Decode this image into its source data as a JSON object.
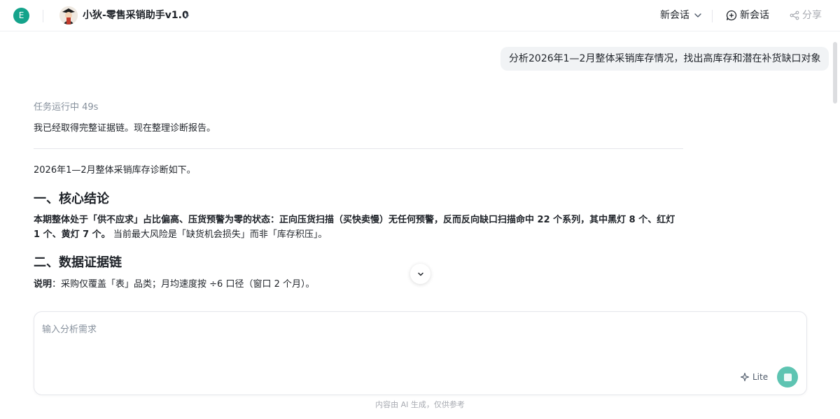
{
  "header": {
    "user_avatar_letter": "E",
    "agent_title": "小狄-零售采销助手v1.0",
    "session_dropdown_label": "新会话",
    "new_session_label": "新会话",
    "share_label": "分享"
  },
  "chat": {
    "user_message": "分析2026年1—2月整体采销库存情况，找出高库存和潜在补货缺口对象",
    "task_status": "任务运行中 49s",
    "assistant_intro": "我已经取得完整证据链。现在整理诊断报告。",
    "report_lead": "2026年1—2月整体采销库存诊断如下。",
    "section1_title": "一、核心结论",
    "section1_bold_line1": "本期整体处于「供不应求」占比偏高、压货预警为零的状态：正向压货扫描（买快卖慢）无任何预警，反而反向缺口扫描命中 22 个系列，其中黑灯 8 个、红灯",
    "section1_bold_line2": "1 个、黄灯 7 个。",
    "section1_normal_line2": "当前最大风险是「缺货机会损失」而非「库存积压」。",
    "section2_title": "二、数据证据链",
    "section2_note_label": "说明",
    "section2_note_text": "：采购仅覆盖「表」品类；月均速度按 ÷6 口径（窗口 2 个月）。"
  },
  "composer": {
    "placeholder": "输入分析需求",
    "mode_label": "Lite"
  },
  "footer": {
    "disclaimer": "内容由 AI 生成，仅供参考"
  },
  "colors": {
    "accent": "#14a38b",
    "send_button": "#5ec4b2",
    "bubble_bg": "#f1f3f5"
  },
  "icons": {
    "agent_avatar": "agent-avatar-icon",
    "dropdown": "chevron-down-icon",
    "new_chat": "new-chat-icon",
    "share": "share-icon",
    "scroll_down": "chevron-down-icon",
    "lite": "sparkle-icon",
    "send": "stop-icon"
  }
}
